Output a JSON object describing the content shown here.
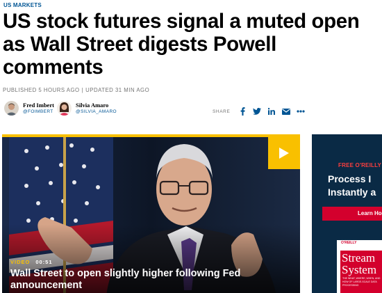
{
  "article": {
    "section": "US MARKETS",
    "headline": "US stock futures signal a muted open as Wall Street digests Powell comments",
    "published": "PUBLISHED 5 HOURS AGO",
    "separator": "|",
    "updated": "UPDATED 31 MIN AGO"
  },
  "authors": [
    {
      "name": "Fred Imbert",
      "handle": "@FOIMBERT"
    },
    {
      "name": "Silvia Amaro",
      "handle": "@SILVIA_AMARO"
    }
  ],
  "share": {
    "label": "SHARE",
    "icons": [
      "facebook-icon",
      "twitter-icon",
      "linkedin-icon",
      "email-icon",
      "more-icon"
    ]
  },
  "video": {
    "tag": "VIDEO",
    "duration": "00:51",
    "title": "Wall Street to open slightly higher following Fed announcement",
    "accent": "#f9c000"
  },
  "ad": {
    "kicker": "FREE O'REILLY",
    "headline_line1": "Process I",
    "headline_line2": "Instantly a",
    "button": "Learn Ho",
    "book_logo": "O'REILLY",
    "book_title_line1": "Stream",
    "book_title_line2": "System",
    "book_subtitle": "THE WHAT, WHERE, WHEN, AND HOW OF LARGE-SCALE DATA PROCESSING"
  },
  "colors": {
    "link": "#005594",
    "meta": "#747474",
    "ad_bg": "#0a2a45",
    "ad_red": "#d3002d"
  }
}
